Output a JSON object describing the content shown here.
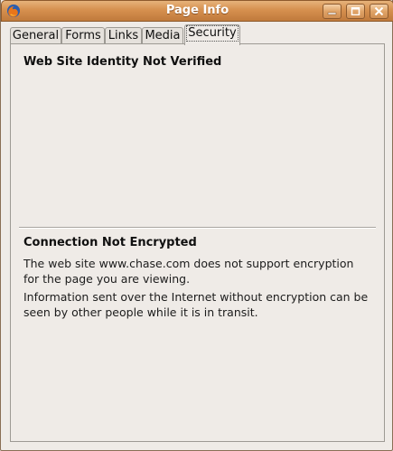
{
  "window": {
    "title": "Page Info",
    "icon": "firefox-icon",
    "controls": {
      "minimize": "minimize-icon",
      "maximize": "maximize-icon",
      "close": "close-icon"
    }
  },
  "tabs": [
    {
      "label": "General",
      "active": false
    },
    {
      "label": "Forms",
      "active": false
    },
    {
      "label": "Links",
      "active": false
    },
    {
      "label": "Media",
      "active": false
    },
    {
      "label": "Security",
      "active": true
    }
  ],
  "security": {
    "identity_heading": "Web Site Identity Not Verified",
    "encryption_heading": "Connection Not Encrypted",
    "encryption_text_1": "The web site www.chase.com does not support encryption for the page you are viewing.",
    "encryption_text_2": "Information sent over the Internet without encryption can be seen by other people while it is in transit."
  },
  "colors": {
    "titlebar": "#d6904f",
    "window_bg": "#efebe7"
  }
}
